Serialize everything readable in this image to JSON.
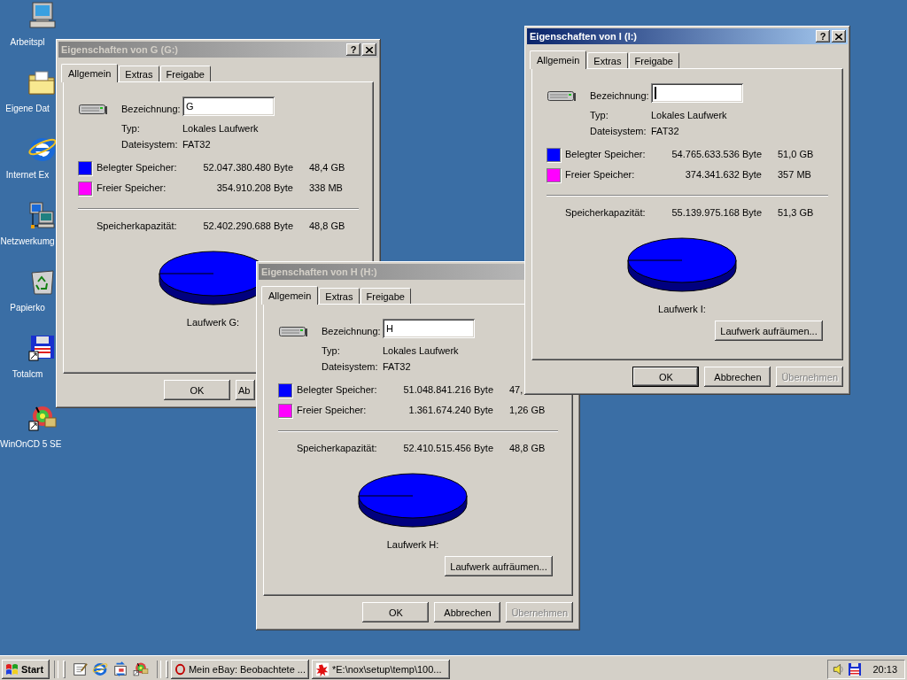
{
  "desktop_icons": [
    {
      "kind": "computer",
      "label": "Arbeitspl"
    },
    {
      "kind": "folder",
      "label": "Eigene Dat"
    },
    {
      "kind": "browser",
      "label": "Internet Ex"
    },
    {
      "kind": "network",
      "label": "Netzwerkumg"
    },
    {
      "kind": "bin",
      "label": "Papierko"
    },
    {
      "kind": "floppy",
      "label": "Totalcm"
    },
    {
      "kind": "disc",
      "label": "WinOnCD 5 SE"
    }
  ],
  "windows": [
    {
      "title": "Eigenschaften von G (G:)",
      "active": false,
      "caption_buttons": [
        {
          "kind": "help",
          "label": "?"
        },
        {
          "kind": "close"
        }
      ],
      "tabs": [
        {
          "label": "Allgemein",
          "selected": true
        },
        {
          "label": "Extras",
          "selected": false
        },
        {
          "label": "Freigabe",
          "selected": false
        }
      ],
      "label_field": {
        "label": "Bezeichnung:",
        "value": "G",
        "focused": false
      },
      "info": [
        {
          "label": "Typ:",
          "value": "Lokales Laufwerk"
        },
        {
          "label": "Dateisystem:",
          "value": "FAT32"
        }
      ],
      "usage": [
        {
          "label": "Belegter Speicher:",
          "bytes": "52.047.380.480 Byte",
          "size": "48,4 GB",
          "color": "#0000ff"
        },
        {
          "label": "Freier Speicher:",
          "bytes": "354.910.208 Byte",
          "size": "338 MB",
          "color": "#ff00ff"
        }
      ],
      "capacity": {
        "label": "Speicherkapazität:",
        "bytes": "52.402.290.688 Byte",
        "size": "48,8 GB"
      },
      "drive_caption": "Laufwerk G:",
      "buttons": [
        {
          "label": "OK",
          "default": false,
          "disabled": false
        },
        {
          "label": "Ab",
          "default": false,
          "disabled": false
        }
      ]
    },
    {
      "title": "Eigenschaften von H (H:)",
      "active": false,
      "tabs": [
        {
          "label": "Allgemein",
          "selected": true
        },
        {
          "label": "Extras",
          "selected": false
        },
        {
          "label": "Freigabe",
          "selected": false
        }
      ],
      "label_field": {
        "label": "Bezeichnung:",
        "value": "H",
        "focused": false
      },
      "info": [
        {
          "label": "Typ:",
          "value": "Lokales Laufwerk"
        },
        {
          "label": "Dateisystem:",
          "value": "FAT32"
        }
      ],
      "usage": [
        {
          "label": "Belegter Speicher:",
          "bytes": "51.048.841.216 Byte",
          "size": "47,",
          "color": "#0000ff"
        },
        {
          "label": "Freier Speicher:",
          "bytes": "1.361.674.240 Byte",
          "size": "1,26 GB",
          "color": "#ff00ff"
        }
      ],
      "capacity": {
        "label": "Speicherkapazität:",
        "bytes": "52.410.515.456 Byte",
        "size": "48,8 GB"
      },
      "drive_caption": "Laufwerk H:",
      "cleanup_button": "Laufwerk aufräumen...",
      "buttons": [
        {
          "label": "OK",
          "default": false,
          "disabled": false
        },
        {
          "label": "Abbrechen",
          "default": false,
          "disabled": false
        },
        {
          "label": "Übernehmen",
          "default": false,
          "disabled": true
        }
      ]
    },
    {
      "title": "Eigenschaften von I (I:)",
      "active": true,
      "caption_buttons": [
        {
          "kind": "help",
          "label": "?"
        },
        {
          "kind": "close"
        }
      ],
      "tabs": [
        {
          "label": "Allgemein",
          "selected": true
        },
        {
          "label": "Extras",
          "selected": false
        },
        {
          "label": "Freigabe",
          "selected": false
        }
      ],
      "label_field": {
        "label": "Bezeichnung:",
        "focused": true
      },
      "info": [
        {
          "label": "Typ:",
          "value": "Lokales Laufwerk"
        },
        {
          "label": "Dateisystem:",
          "value": "FAT32"
        }
      ],
      "usage": [
        {
          "label": "Belegter Speicher:",
          "bytes": "54.765.633.536 Byte",
          "size": "51,0 GB",
          "color": "#0000ff"
        },
        {
          "label": "Freier Speicher:",
          "bytes": "374.341.632 Byte",
          "size": "357 MB",
          "color": "#ff00ff"
        }
      ],
      "capacity": {
        "label": "Speicherkapazität:",
        "bytes": "55.139.975.168 Byte",
        "size": "51,3 GB"
      },
      "drive_caption": "Laufwerk I:",
      "cleanup_button": "Laufwerk aufräumen...",
      "buttons": [
        {
          "label": "OK",
          "default": true,
          "disabled": false
        },
        {
          "label": "Abbrechen",
          "default": false,
          "disabled": false
        },
        {
          "label": "Übernehmen",
          "default": false,
          "disabled": true
        }
      ]
    }
  ],
  "taskbar": {
    "start": "Start",
    "quick_launch": [
      {
        "kind": "notepad"
      },
      {
        "kind": "browser"
      },
      {
        "kind": "mail"
      },
      {
        "kind": "disc"
      }
    ],
    "tasks": [
      {
        "kind": "opera",
        "label": "Mein eBay: Beobachtete ..."
      },
      {
        "kind": "splat",
        "label": "*E:\\nox\\setup\\temp\\100..."
      }
    ],
    "tray": [
      {
        "kind": "speaker"
      },
      {
        "kind": "floppy"
      }
    ],
    "clock": "20:13"
  }
}
